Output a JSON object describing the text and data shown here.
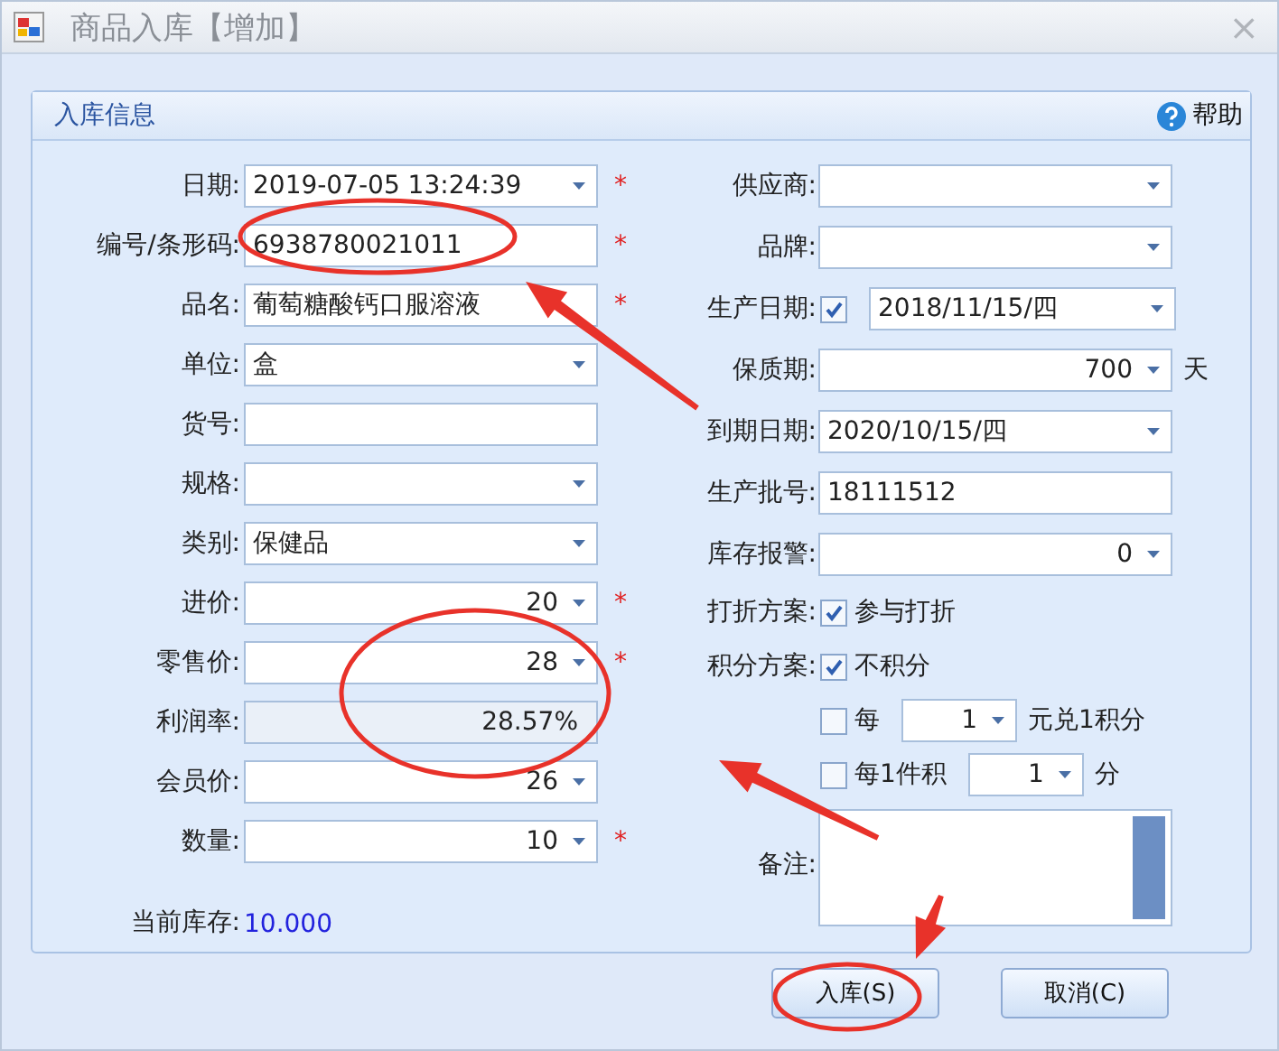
{
  "window": {
    "title": "商品入库【增加】",
    "close": "×"
  },
  "group": {
    "title": "入库信息",
    "help": "帮助"
  },
  "left_fields": [
    {
      "label": "日期:",
      "kind": "dropdown",
      "value": "2019-07-05 13:24:39",
      "required": "*"
    },
    {
      "label": "编号/条形码:",
      "kind": "text",
      "value": "6938780021011",
      "required": "*"
    },
    {
      "label": "品名:",
      "kind": "text",
      "value": "葡萄糖酸钙口服溶液",
      "required": "*"
    },
    {
      "label": "单位:",
      "kind": "dropdown",
      "value": "盒"
    },
    {
      "label": "货号:",
      "kind": "text"
    },
    {
      "label": "规格:",
      "kind": "dropdown"
    },
    {
      "label": "类别:",
      "kind": "dropdown",
      "value": "保健品"
    },
    {
      "label": "进价:",
      "kind": "number",
      "value": "20",
      "required": "*"
    },
    {
      "label": "零售价:",
      "kind": "number",
      "value": "28",
      "required": "*"
    },
    {
      "label": "利润率:",
      "kind": "readonly",
      "value": "28.57%"
    },
    {
      "label": "会员价:",
      "kind": "number",
      "value": "26"
    },
    {
      "label": "数量:",
      "kind": "number",
      "value": "10",
      "required": "*"
    },
    {
      "label": "当前库存:",
      "kind": "info",
      "value": "10.000"
    }
  ],
  "right_fields": [
    {
      "label": "供应商:",
      "kind": "dropdown"
    },
    {
      "label": "品牌:",
      "kind": "dropdown"
    },
    {
      "label": "生产日期:",
      "kind": "date-check",
      "checked": true,
      "value": "2018/11/15/四"
    },
    {
      "label": "保质期:",
      "kind": "number",
      "value": "700",
      "unit": "天"
    },
    {
      "label": "到期日期:",
      "kind": "dropdown",
      "value": "2020/10/15/四"
    },
    {
      "label": "生产批号:",
      "kind": "text",
      "value": "18111512"
    },
    {
      "label": "库存报警:",
      "kind": "number",
      "value": "0"
    },
    {
      "label": "打折方案:",
      "kind": "check",
      "checked": true,
      "text": "参与打折"
    },
    {
      "label": "积分方案:",
      "kind": "check",
      "checked": true,
      "text": "不积分"
    },
    {
      "kind": "check-spin",
      "checked": false,
      "text": "每",
      "value": "1",
      "unit": "元兑1积分"
    },
    {
      "kind": "check-spin",
      "checked": false,
      "text": "每1件积",
      "value": "1",
      "unit": "分"
    },
    {
      "label": "备注:",
      "kind": "textarea"
    }
  ],
  "buttons": [
    {
      "label": "入库(S)"
    },
    {
      "label": "取消(C)"
    }
  ],
  "circle_marks": [
    {
      "color": "#e8322a"
    },
    {
      "color": "#e8322a"
    },
    {
      "color": "#e8322a"
    }
  ],
  "arrow_marks": [
    {
      "color": "#e8322a"
    },
    {
      "color": "#e8322a"
    },
    {
      "color": "#e8322a"
    }
  ]
}
